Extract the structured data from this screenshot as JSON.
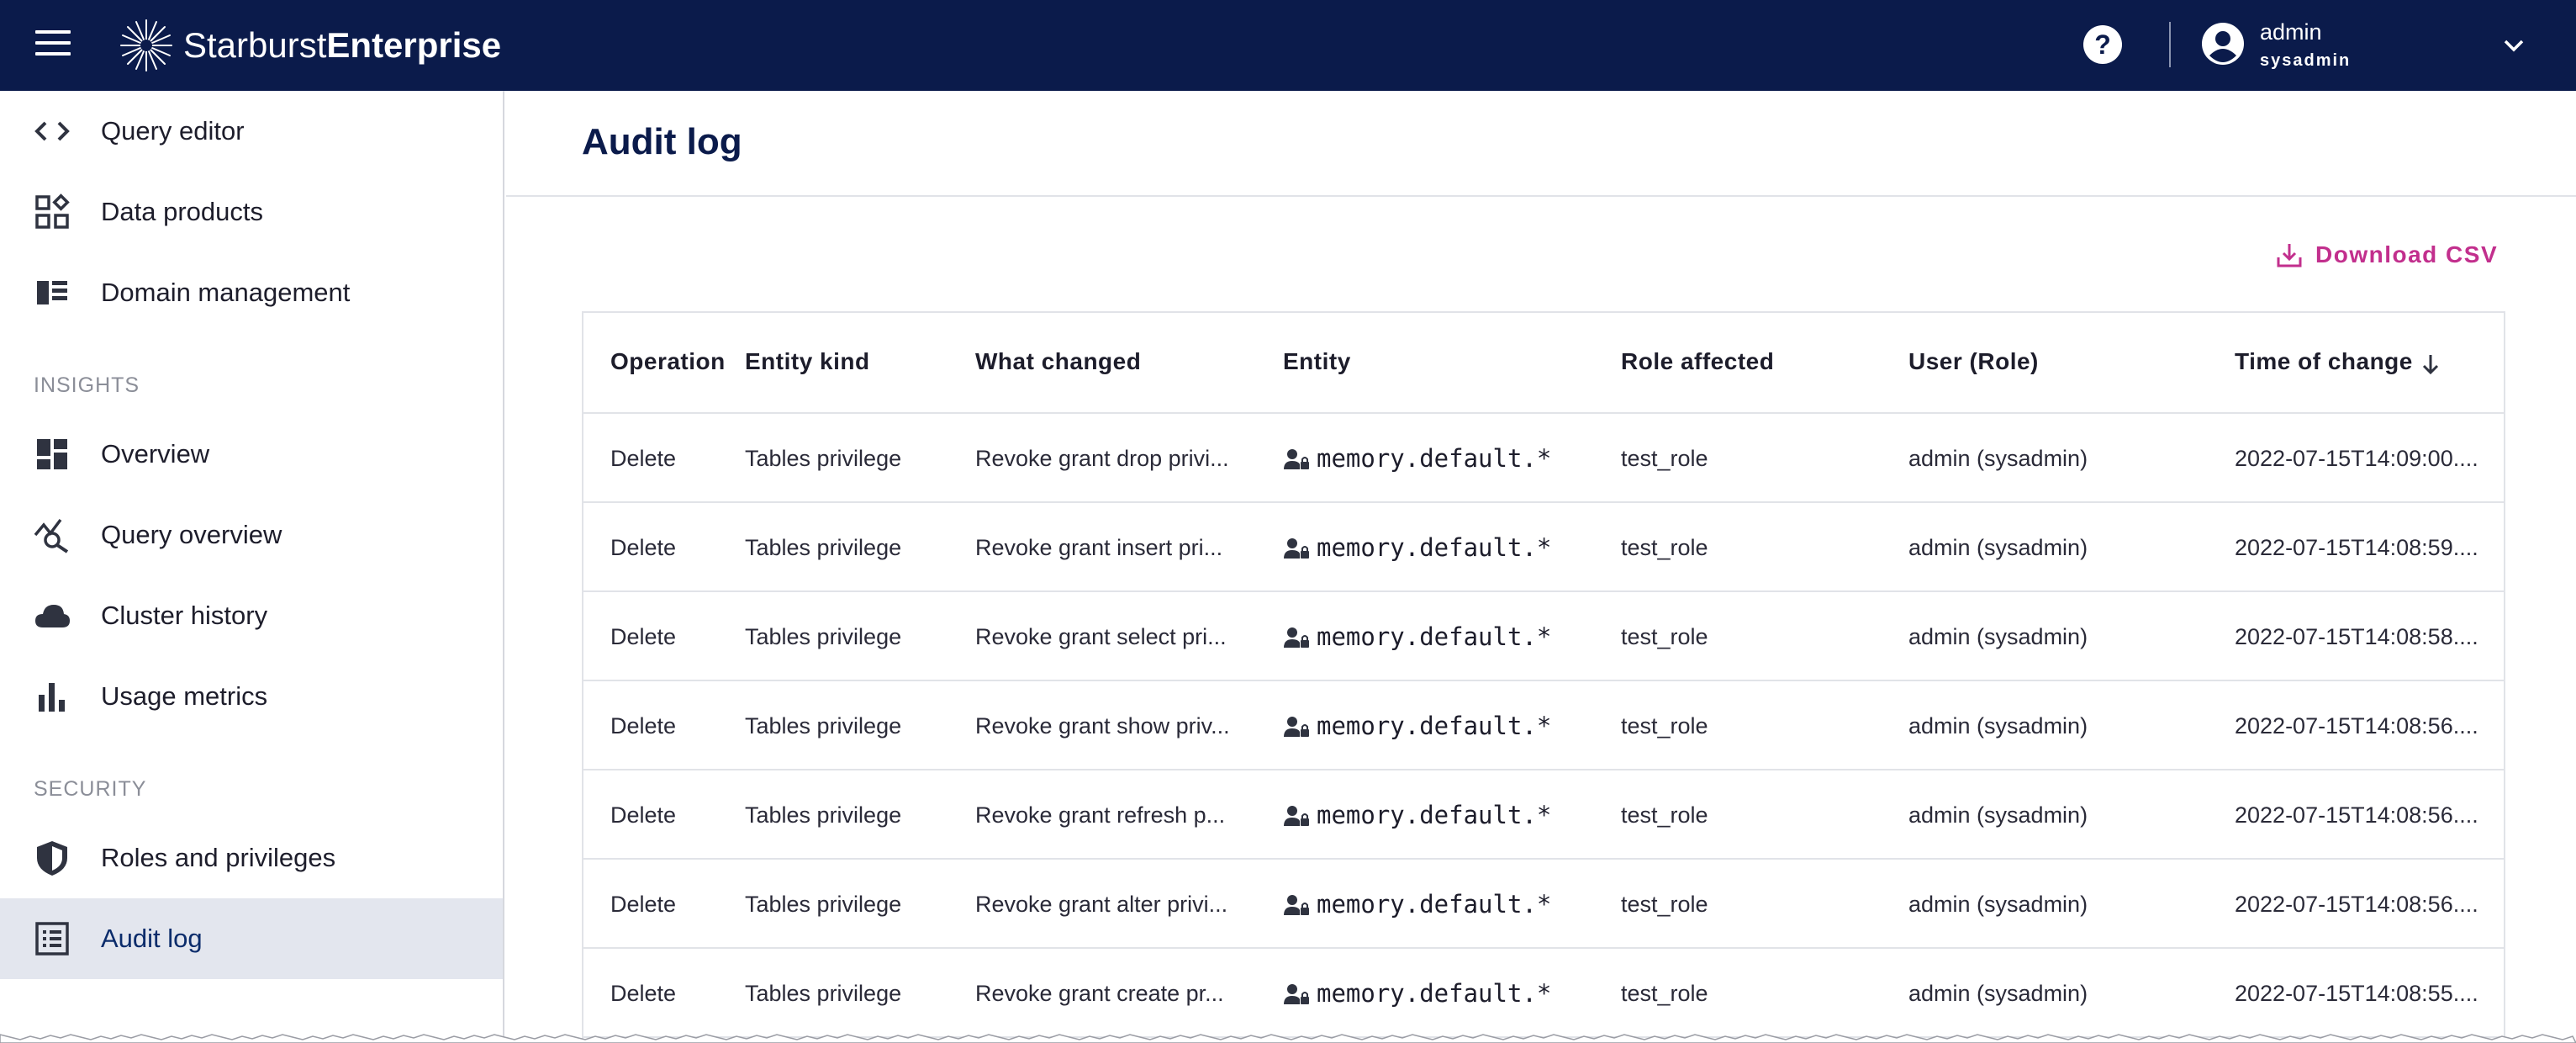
{
  "header": {
    "logo_light": "Starburst",
    "logo_bold": "Enterprise",
    "user_name": "admin",
    "user_role": "sysadmin",
    "icons": [
      "menu-icon",
      "starburst-logo",
      "help-icon",
      "account-icon",
      "chevron-down-icon"
    ]
  },
  "sidebar": {
    "items": [
      {
        "label": "Query editor",
        "icon": "code-icon"
      },
      {
        "label": "Data products",
        "icon": "data-products-icon"
      },
      {
        "label": "Domain management",
        "icon": "domain-icon"
      },
      {
        "label": "Overview",
        "icon": "dashboard-icon"
      },
      {
        "label": "Query overview",
        "icon": "query-insights-icon"
      },
      {
        "label": "Cluster history",
        "icon": "cloud-icon"
      },
      {
        "label": "Usage metrics",
        "icon": "bar-chart-icon"
      },
      {
        "label": "Roles and privileges",
        "icon": "shield-icon"
      },
      {
        "label": "Audit log",
        "icon": "list-alt-icon"
      }
    ],
    "sections": {
      "insights": "INSIGHTS",
      "security": "SECURITY"
    },
    "active": "Audit log"
  },
  "main": {
    "title": "Audit log",
    "download_label": "Download CSV",
    "columns": [
      "Operation",
      "Entity kind",
      "What changed",
      "Entity",
      "Role affected",
      "User (Role)",
      "Time of change"
    ],
    "rows": [
      {
        "operation": "Delete",
        "entity_kind": "Tables privilege",
        "what_changed": "Revoke grant drop privi...",
        "entity": "memory.default.*",
        "role": "test_role",
        "user": "admin (sysadmin)",
        "time": "2022-07-15T14:09:00...."
      },
      {
        "operation": "Delete",
        "entity_kind": "Tables privilege",
        "what_changed": "Revoke grant insert pri...",
        "entity": "memory.default.*",
        "role": "test_role",
        "user": "admin (sysadmin)",
        "time": "2022-07-15T14:08:59...."
      },
      {
        "operation": "Delete",
        "entity_kind": "Tables privilege",
        "what_changed": "Revoke grant select pri...",
        "entity": "memory.default.*",
        "role": "test_role",
        "user": "admin (sysadmin)",
        "time": "2022-07-15T14:08:58...."
      },
      {
        "operation": "Delete",
        "entity_kind": "Tables privilege",
        "what_changed": "Revoke grant show priv...",
        "entity": "memory.default.*",
        "role": "test_role",
        "user": "admin (sysadmin)",
        "time": "2022-07-15T14:08:56...."
      },
      {
        "operation": "Delete",
        "entity_kind": "Tables privilege",
        "what_changed": "Revoke grant refresh p...",
        "entity": "memory.default.*",
        "role": "test_role",
        "user": "admin (sysadmin)",
        "time": "2022-07-15T14:08:56...."
      },
      {
        "operation": "Delete",
        "entity_kind": "Tables privilege",
        "what_changed": "Revoke grant alter privi...",
        "entity": "memory.default.*",
        "role": "test_role",
        "user": "admin (sysadmin)",
        "time": "2022-07-15T14:08:56...."
      },
      {
        "operation": "Delete",
        "entity_kind": "Tables privilege",
        "what_changed": "Revoke grant create pr...",
        "entity": "memory.default.*",
        "role": "test_role",
        "user": "admin (sysadmin)",
        "time": "2022-07-15T14:08:55...."
      }
    ]
  },
  "colors": {
    "topbar": "#0b1b4b",
    "accent": "#c22f8d",
    "active_bg": "#e3e6ee"
  }
}
